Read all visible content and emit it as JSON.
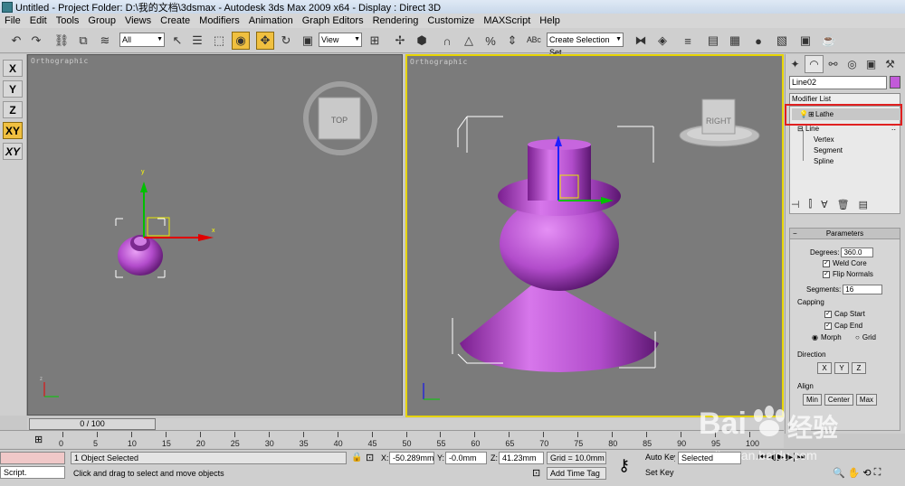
{
  "window": {
    "title": "Untitled    - Project Folder: D:\\我的文档\\3dsmax    - Autodesk 3ds Max  2009 x64    - Display : Direct 3D"
  },
  "menu": [
    "File",
    "Edit",
    "Tools",
    "Group",
    "Views",
    "Create",
    "Modifiers",
    "Animation",
    "Graph Editors",
    "Rendering",
    "Customize",
    "MAXScript",
    "Help"
  ],
  "toolbar": {
    "selection_filter": "All",
    "reference_coord": "View",
    "named_selection_placeholder": "Create Selection Set"
  },
  "axis_constraints": [
    "X",
    "Y",
    "Z",
    "XY",
    "XY"
  ],
  "viewports": {
    "left_label": "Orthographic",
    "right_label": "Orthographic",
    "left_viewcube": "TOP",
    "right_viewcube": "RIGHT"
  },
  "command_panel": {
    "object_name": "Line02",
    "object_color": "#c25ad9",
    "modifier_list": "Modifier List",
    "stack": {
      "lathe": "Lathe",
      "line": "Line",
      "vertex": "Vertex",
      "segment": "Segment",
      "spline": "Spline"
    },
    "parameters": {
      "title": "Parameters",
      "degrees_label": "Degrees:",
      "degrees_value": "360.0",
      "weld_core": "Weld Core",
      "flip_normals": "Flip Normals",
      "segments_label": "Segments:",
      "segments_value": "16",
      "capping_label": "Capping",
      "cap_start": "Cap Start",
      "cap_end": "Cap End",
      "morph": "Morph",
      "grid": "Grid",
      "direction_label": "Direction",
      "dir_x": "X",
      "dir_y": "Y",
      "dir_z": "Z",
      "align_label": "Align",
      "align_min": "Min",
      "align_center": "Center",
      "align_max": "Max"
    }
  },
  "timeline": {
    "slider": "0 / 100",
    "ticks": [
      "0",
      "5",
      "10",
      "15",
      "20",
      "25",
      "30",
      "35",
      "40",
      "45",
      "50",
      "55",
      "60",
      "65",
      "70",
      "75",
      "80",
      "85",
      "90",
      "95",
      "100"
    ]
  },
  "status": {
    "maxscript": "Script.",
    "selection": "1 Object Selected",
    "prompt": "Click and drag to select and move objects",
    "x_label": "X:",
    "x_value": "-50.289mm",
    "y_label": "Y:",
    "y_value": "-0.0mm",
    "z_label": "Z:",
    "z_value": "41.23mm",
    "grid": "Grid = 10.0mm",
    "add_time_tag": "Add Time Tag",
    "auto_key": "Auto Key",
    "set_key": "Set Key",
    "key_filter": "Selected"
  },
  "watermark": {
    "brand": "Bai",
    "brand_cn": "经验",
    "url": "jingyan.baidu.com"
  }
}
